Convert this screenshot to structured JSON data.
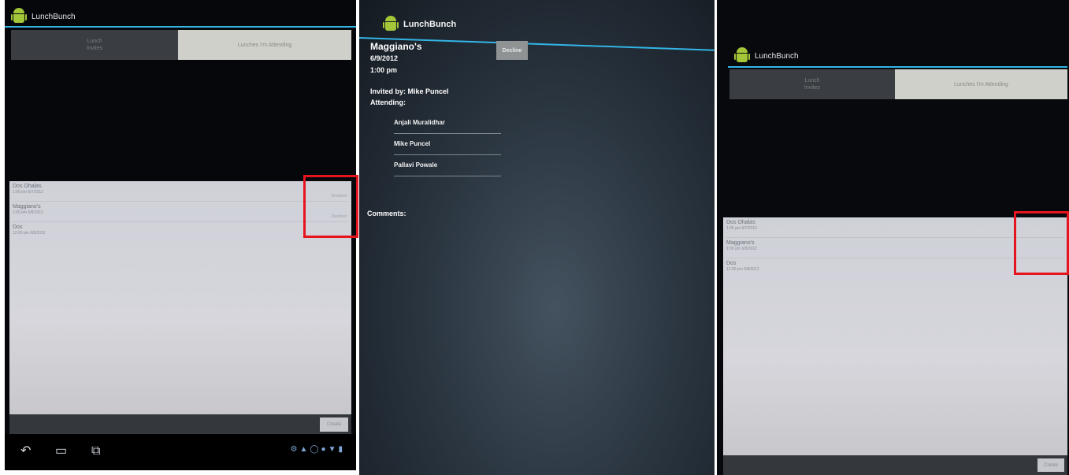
{
  "app": {
    "title": "LunchBunch"
  },
  "lunches_screen": {
    "tabs": [
      {
        "line1": "Lunch",
        "line2": "Invites"
      },
      {
        "line1": "Lunches I'm Attending",
        "line2": ""
      }
    ],
    "items": [
      {
        "title": "Dos Ohalas",
        "subtitle": "1:00 pm    6/7/2012",
        "status": "Declined"
      },
      {
        "title": "Maggiano's",
        "subtitle": "1:00 pm    6/8/2012",
        "status": "Declined"
      },
      {
        "title": "Dos",
        "subtitle": "12:00 pm    6/8/2012",
        "status": ""
      }
    ],
    "bottom_button": "Create"
  },
  "lunches_screen_right": {
    "items": [
      {
        "title": "Dos Ohalas",
        "subtitle": "1:00 pm    6/7/2012"
      },
      {
        "title": "Maggiano's",
        "subtitle": "1:00 pm    6/8/2012"
      },
      {
        "title": "Dos",
        "subtitle": "12:00 pm    6/8/2012"
      }
    ]
  },
  "detail_screen": {
    "restaurant": "Maggiano's",
    "date": "6/9/2012",
    "time": "1:00 pm",
    "invited_by": "Invited by: Mike Puncel",
    "attending_label": "Attending:",
    "attendees": [
      "Anjali Muralidhar",
      "Mike Puncel",
      "Pallavi Powale"
    ],
    "decline_label": "Decline",
    "comments_label": "Comments:"
  },
  "icons": {
    "back": "back-icon",
    "home": "home-icon",
    "recent": "recent-apps-icon"
  },
  "colors": {
    "holo_accent": "#33b5e5",
    "highlight": "#e6141f",
    "android_green": "#a4c639"
  }
}
